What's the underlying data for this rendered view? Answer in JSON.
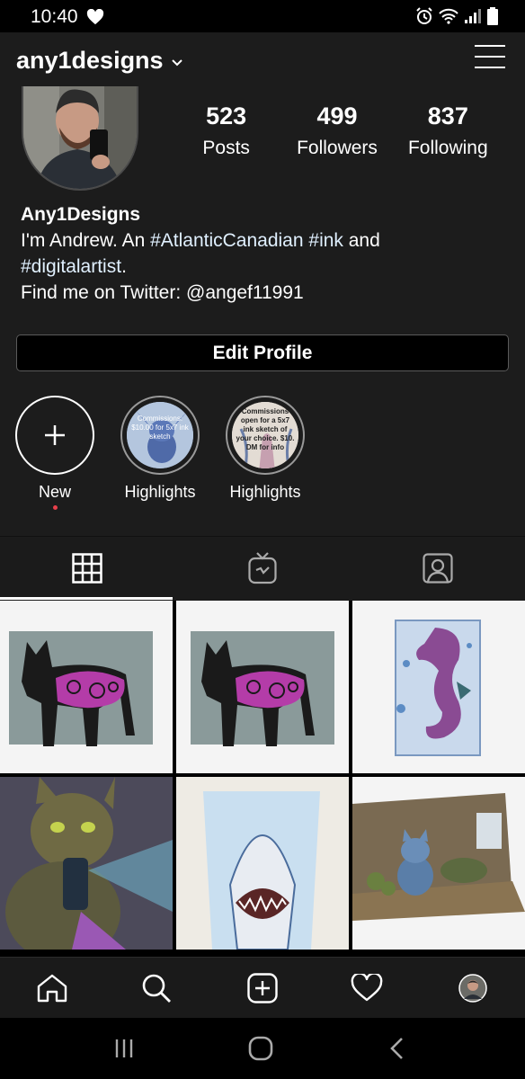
{
  "status_bar": {
    "time": "10:40"
  },
  "profile": {
    "username": "any1designs",
    "stats": [
      {
        "value": "523",
        "label": "Posts"
      },
      {
        "value": "499",
        "label": "Followers"
      },
      {
        "value": "837",
        "label": "Following"
      }
    ],
    "display_name": "Any1Designs",
    "bio_line1_prefix": "I'm Andrew. An ",
    "bio_tag1": "#AtlanticCanadian",
    "bio_line1_mid": " ",
    "bio_tag2": "#ink",
    "bio_line1_suffix": " and",
    "bio_tag3": "#digitalartist",
    "bio_line2_suffix": ".",
    "bio_line3": "Find me on Twitter: @angef11991",
    "edit_button": "Edit Profile"
  },
  "highlights": [
    {
      "label": "New"
    },
    {
      "label": "Highlights",
      "story_text": "Commissions: $10.00 for 5x7 ink sketch"
    },
    {
      "label": "Highlights",
      "story_text": "Commissions open for a 5x7 ink sketch of your choice. $10. DM for info"
    }
  ],
  "tabs": [
    {
      "name": "grid",
      "icon": "grid-icon",
      "active": true
    },
    {
      "name": "igtv",
      "icon": "igtv-icon",
      "active": false
    },
    {
      "name": "tagged",
      "icon": "tagged-icon",
      "active": false
    }
  ],
  "posts": [
    {
      "subject": "purple wolf ink"
    },
    {
      "subject": "purple wolf ink"
    },
    {
      "subject": "purple seahorse ink"
    },
    {
      "subject": "cat with spray"
    },
    {
      "subject": "shark ink"
    },
    {
      "subject": "blue cat in room"
    }
  ],
  "colors": {
    "background": "#1c1c1c",
    "text": "#ffffff",
    "accent_dot": "#e8404b"
  }
}
